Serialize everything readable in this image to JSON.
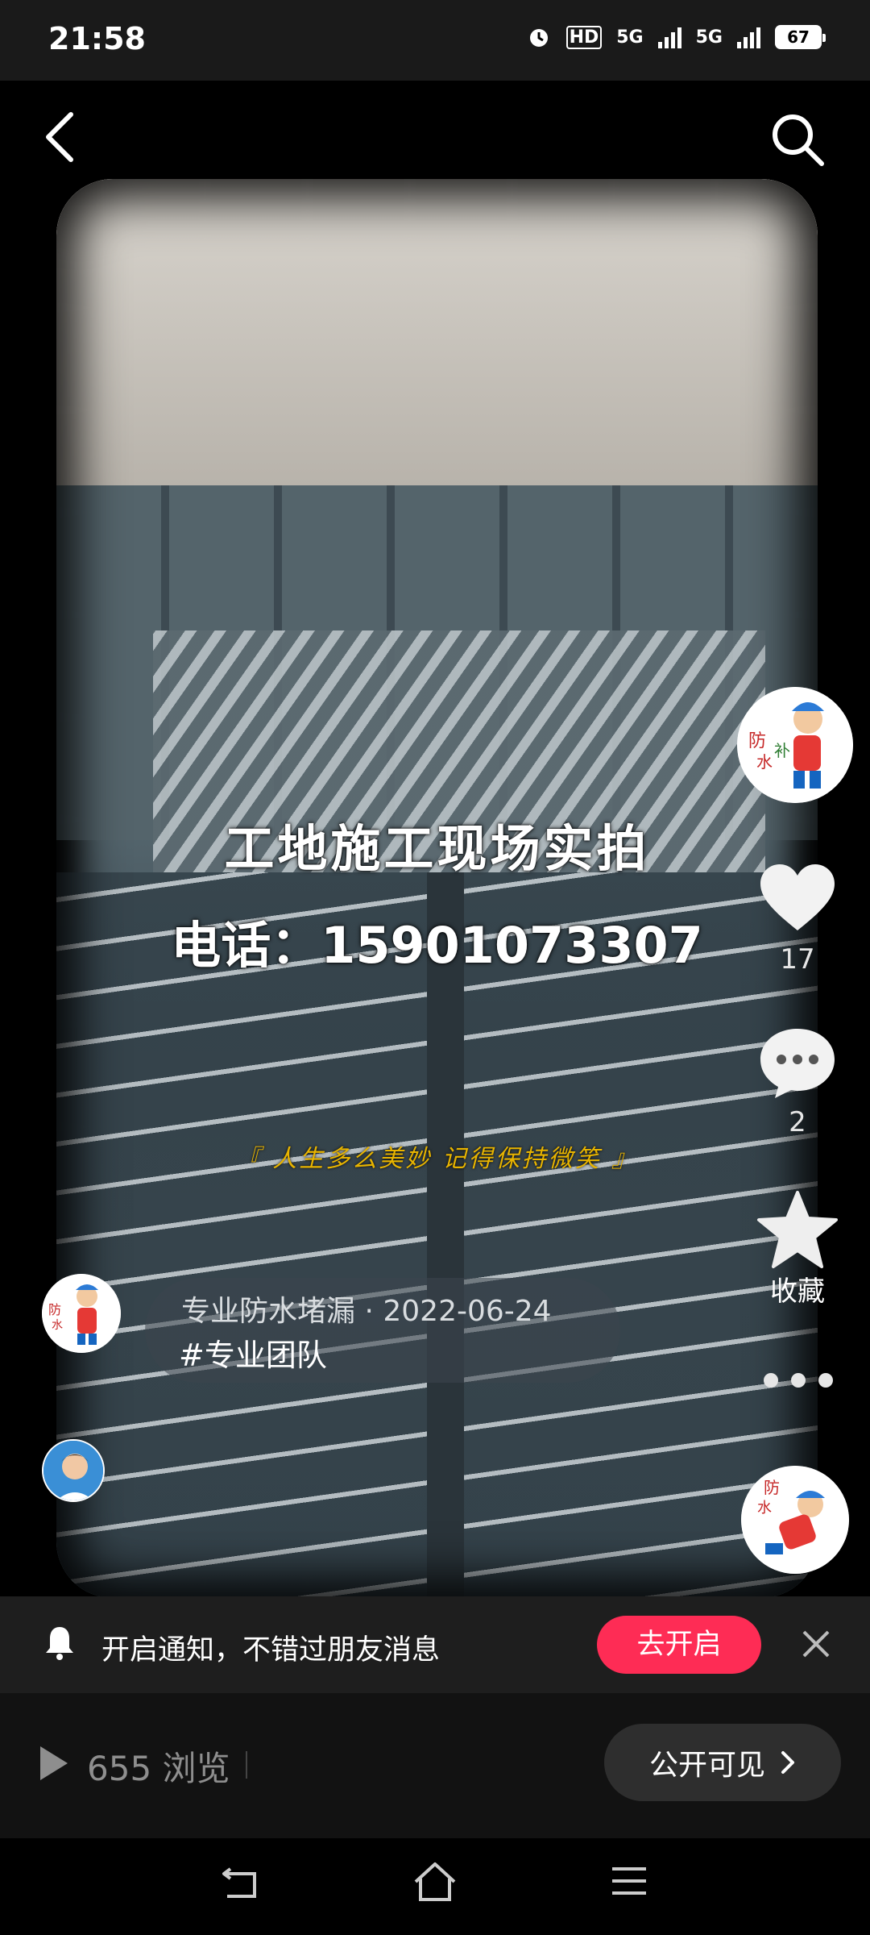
{
  "status_bar": {
    "time": "21:58",
    "hd_label": "HD",
    "network_1": "5G",
    "network_2": "5G",
    "battery": "67"
  },
  "video": {
    "caption_line1": "工地施工现场实拍",
    "caption_line2": "电话：15901073307",
    "subtitle": "『 人生多么美妙  记得保持微笑 』",
    "author": "专业防水堵漏",
    "date": "2022-06-24",
    "hashtag": "#专业团队"
  },
  "rail": {
    "like_count": "17",
    "comment_count": "2",
    "favorite_label": "收藏"
  },
  "notification": {
    "text": "开启通知，不错过朋友消息",
    "button": "去开启"
  },
  "bottom": {
    "views": "655 浏览",
    "visibility": "公开可见"
  },
  "colors": {
    "accent": "#fe2c55",
    "background": "#000000"
  },
  "icons": [
    "back-arrow-icon",
    "search-icon",
    "heart-icon",
    "comment-icon",
    "star-icon",
    "more-dots-icon",
    "bell-icon",
    "close-icon",
    "play-icon",
    "chevron-right-icon",
    "nav-back-icon",
    "nav-home-icon",
    "nav-menu-icon"
  ]
}
